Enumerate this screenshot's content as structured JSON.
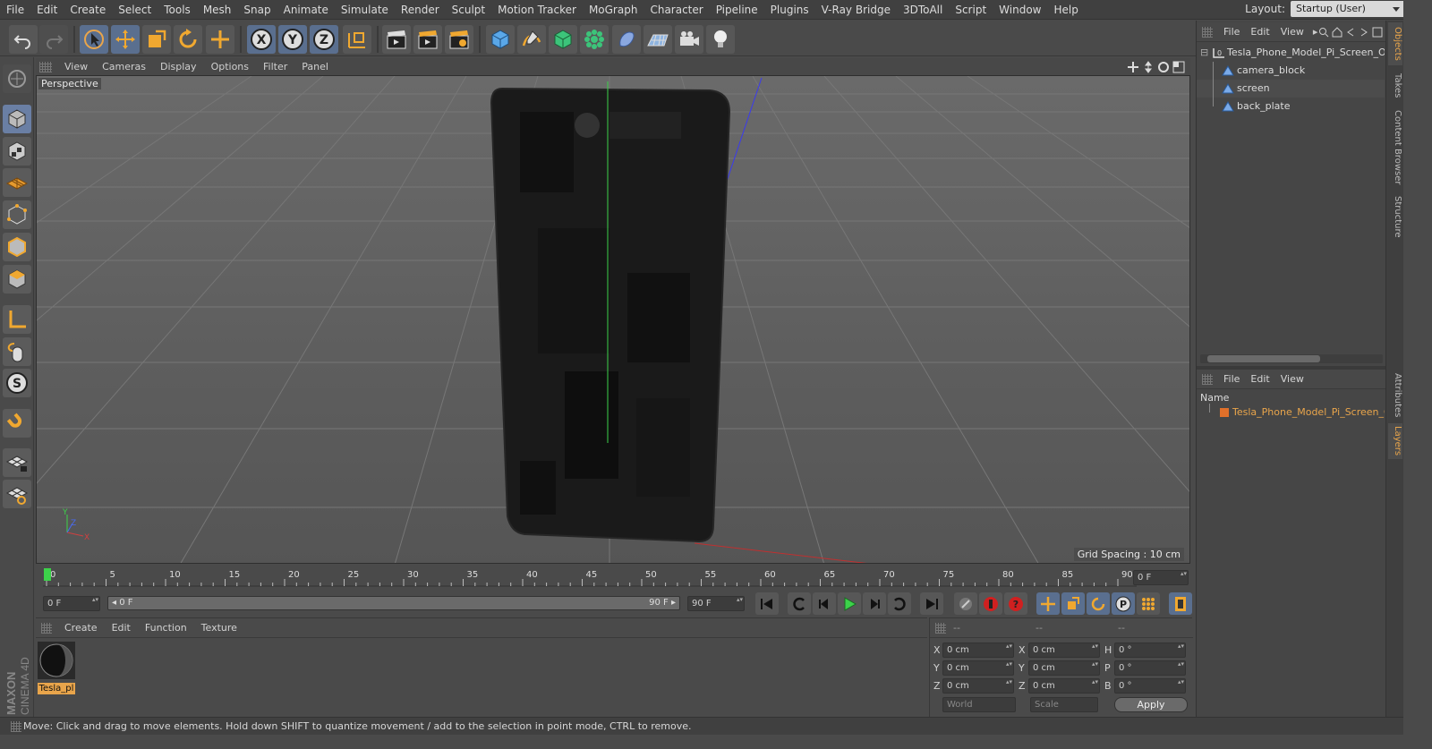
{
  "menubar": {
    "items": [
      "File",
      "Edit",
      "Create",
      "Select",
      "Tools",
      "Mesh",
      "Snap",
      "Animate",
      "Simulate",
      "Render",
      "Sculpt",
      "Motion Tracker",
      "MoGraph",
      "Character",
      "Pipeline",
      "Plugins",
      "V-Ray Bridge",
      "3DToAll",
      "Script",
      "Window",
      "Help"
    ],
    "layout_label": "Layout:",
    "layout_value": "Startup (User)"
  },
  "viewport": {
    "menu": [
      "View",
      "Cameras",
      "Display",
      "Options",
      "Filter",
      "Panel"
    ],
    "label": "Perspective",
    "grid_spacing": "Grid Spacing : 10 cm",
    "axis": {
      "y": "Y",
      "z": "Z",
      "x": "X"
    }
  },
  "timeline": {
    "ticks": [
      "0",
      "5",
      "10",
      "15",
      "20",
      "25",
      "30",
      "35",
      "40",
      "45",
      "50",
      "55",
      "60",
      "65",
      "70",
      "75",
      "80",
      "85",
      "90"
    ],
    "current_field": "0 F"
  },
  "anim": {
    "start_field": "0 F",
    "range_left": "0 F",
    "range_right": "90 F",
    "end_field": "90 F"
  },
  "material_panel": {
    "menu": [
      "Create",
      "Edit",
      "Function",
      "Texture"
    ],
    "material_name": "Tesla_pl"
  },
  "coords": {
    "headers": [
      "--",
      "--",
      "--"
    ],
    "rows": [
      {
        "a": "X",
        "av": "0 cm",
        "b": "X",
        "bv": "0 cm",
        "c": "H",
        "cv": "0 °"
      },
      {
        "a": "Y",
        "av": "0 cm",
        "b": "Y",
        "bv": "0 cm",
        "c": "P",
        "cv": "0 °"
      },
      {
        "a": "Z",
        "av": "0 cm",
        "b": "Z",
        "bv": "0 cm",
        "c": "B",
        "cv": "0 °"
      }
    ],
    "world": "World",
    "scale": "Scale",
    "apply": "Apply"
  },
  "objects_panel": {
    "menu": [
      "File",
      "Edit",
      "View"
    ],
    "root": "Tesla_Phone_Model_Pi_Screen_Off",
    "children": [
      "camera_block",
      "screen",
      "back_plate"
    ]
  },
  "layers_panel": {
    "menu": [
      "File",
      "Edit",
      "View"
    ],
    "header": "Name",
    "layer": "Tesla_Phone_Model_Pi_Screen_Off",
    "layer_color": "#e0702a"
  },
  "vertical_tabs": [
    "Objects",
    "Takes",
    "Content Browser",
    "Structure",
    "Attributes",
    "Layers"
  ],
  "status": "Move: Click and drag to move elements. Hold down SHIFT to quantize movement / add to the selection in point mode, CTRL to remove.",
  "brand": {
    "line1": "MAXON",
    "line2": "CINEMA 4D"
  },
  "colors": {
    "accent": "#e9a54b",
    "selected": "#5a6f8f",
    "material_label_bg": "#e9a54b"
  }
}
